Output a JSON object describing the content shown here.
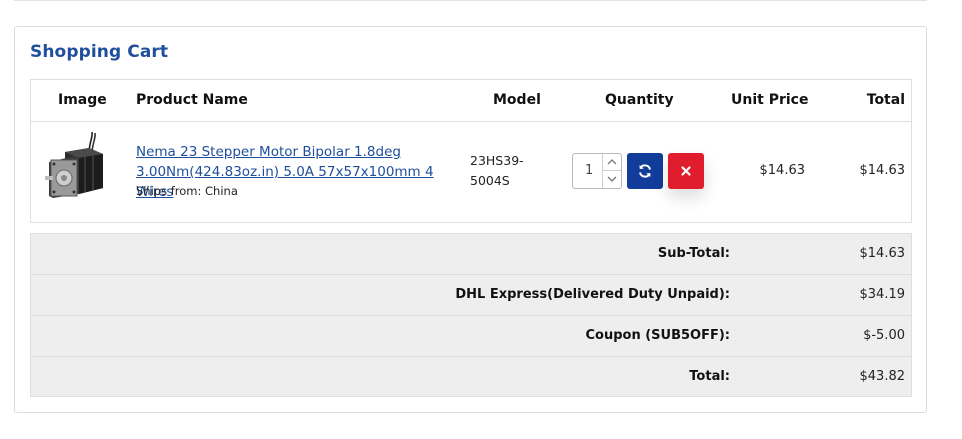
{
  "cart": {
    "title": "Shopping Cart",
    "columns": {
      "image": "Image",
      "product_name": "Product Name",
      "model": "Model",
      "quantity": "Quantity",
      "unit_price": "Unit Price",
      "total": "Total"
    },
    "items": [
      {
        "name": "Nema 23 Stepper Motor Bipolar 1.8deg 3.00Nm(424.83oz.in) 5.0A 57x57x100mm 4 Wires",
        "ships_from": "Ships from: China",
        "model_line1": "23HS39-",
        "model_line2": "5004S",
        "quantity": "1",
        "unit_price": "$14.63",
        "total": "$14.63",
        "icons": {
          "image": "stepper-motor-thumbnail",
          "refresh": "refresh-icon",
          "remove": "close-icon",
          "spin_up": "chevron-up-icon",
          "spin_down": "chevron-down-icon"
        }
      }
    ]
  },
  "totals": [
    {
      "label": "Sub-Total:",
      "value": "$14.63"
    },
    {
      "label": "DHL Express(Delivered Duty Unpaid):",
      "value": "$34.19"
    },
    {
      "label": "Coupon (SUB5OFF):",
      "value": "$-5.00"
    },
    {
      "label": "Total:",
      "value": "$43.82"
    }
  ],
  "colors": {
    "title": "#1f4f9c",
    "link": "#1f4f9c",
    "refresh_button": "#123c9a",
    "remove_button": "#e01d2c",
    "totals_background": "#eeeeee"
  }
}
